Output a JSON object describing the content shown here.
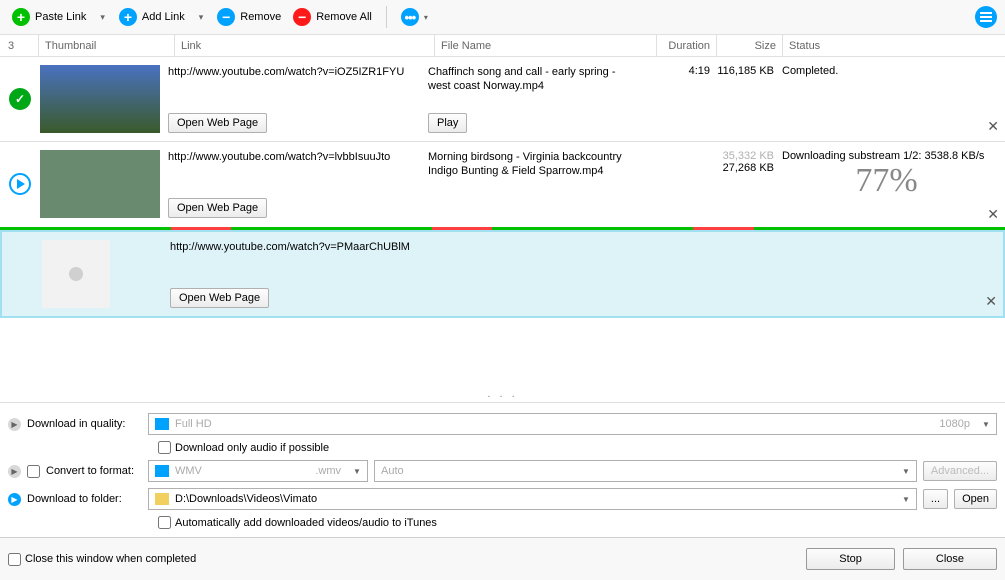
{
  "toolbar": {
    "paste": "Paste Link",
    "add": "Add Link",
    "remove": "Remove",
    "removeAll": "Remove All"
  },
  "headers": {
    "count": "3",
    "thumb": "Thumbnail",
    "link": "Link",
    "fname": "File Name",
    "dur": "Duration",
    "size": "Size",
    "status": "Status"
  },
  "rows": [
    {
      "link": "http://www.youtube.com/watch?v=iOZ5IZR1FYU",
      "fname": "Chaffinch song and call - early spring - west coast Norway.mp4",
      "dur": "4:19",
      "size": "116,185 KB",
      "status": "Completed.",
      "openWeb": "Open Web Page",
      "play": "Play"
    },
    {
      "link": "http://www.youtube.com/watch?v=lvbbIsuuJto",
      "fname": "Morning birdsong - Virginia backcountry Indigo Bunting & Field Sparrow.mp4",
      "sizeFaded": "35,332 KB",
      "size": "27,268 KB",
      "statusLine": "Downloading substream 1/2: 3538.8 KB/s",
      "percent": "77%",
      "openWeb": "Open Web Page"
    },
    {
      "link": "http://www.youtube.com/watch?v=PMaarChUBlM",
      "openWeb": "Open Web Page"
    }
  ],
  "settings": {
    "qualityLabel": "Download in quality:",
    "qualityValue": "Full HD",
    "qualityRes": "1080p",
    "audioOnly": "Download only audio if possible",
    "convertLabel": "Convert to format:",
    "convertValue": "WMV",
    "convertExt": ".wmv",
    "autoValue": "Auto",
    "advanced": "Advanced...",
    "folderLabel": "Download to folder:",
    "folderValue": "D:\\Downloads\\Videos\\Vimato",
    "browse": "...",
    "open": "Open",
    "itunes": "Automatically add downloaded videos/audio to iTunes"
  },
  "footer": {
    "closeWhen": "Close this window when completed",
    "stop": "Stop",
    "close": "Close"
  }
}
